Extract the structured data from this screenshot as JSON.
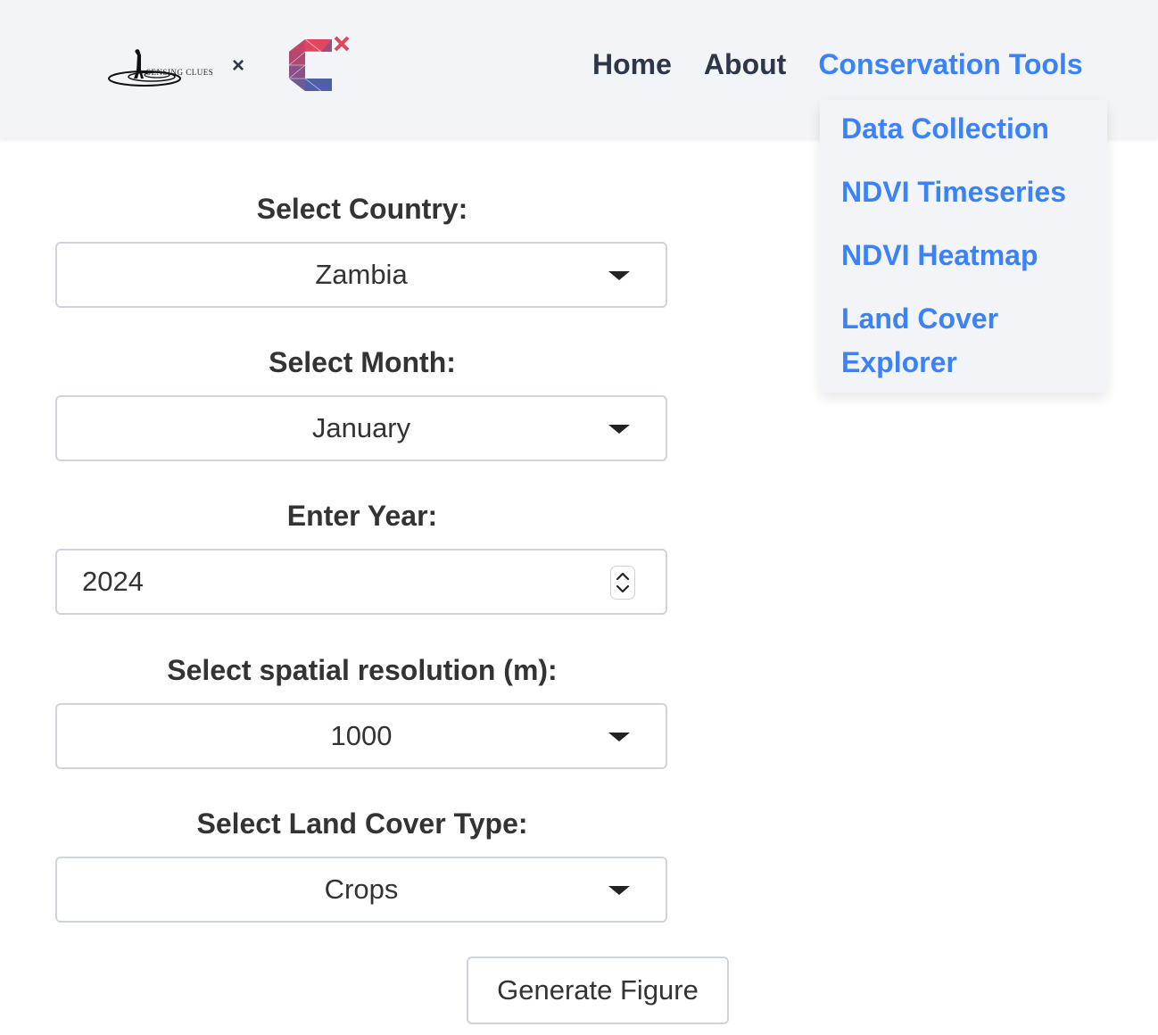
{
  "navbar": {
    "brand_logo_1_text": "SENSING CLUES",
    "brand_separator": "×",
    "links": [
      {
        "label": "Home"
      },
      {
        "label": "About"
      },
      {
        "label": "Conservation Tools",
        "active": true
      }
    ],
    "dropdown_items": [
      {
        "label": "Data Collection"
      },
      {
        "label": "NDVI Timeseries"
      },
      {
        "label": "NDVI Heatmap"
      },
      {
        "label": "Land Cover Explorer"
      }
    ]
  },
  "form": {
    "country": {
      "label": "Select Country:",
      "value": "Zambia"
    },
    "month": {
      "label": "Select Month:",
      "value": "January"
    },
    "year": {
      "label": "Enter Year:",
      "value": "2024"
    },
    "resolution": {
      "label": "Select spatial resolution (m):",
      "value": "1000"
    },
    "land_cover": {
      "label": "Select Land Cover Type:",
      "value": "Crops"
    },
    "submit_label": "Generate Figure"
  },
  "colors": {
    "accent": "#3b82f6",
    "nav_text": "#2d3748",
    "navbar_bg": "#f2f4f7",
    "border": "#cfd4da"
  }
}
